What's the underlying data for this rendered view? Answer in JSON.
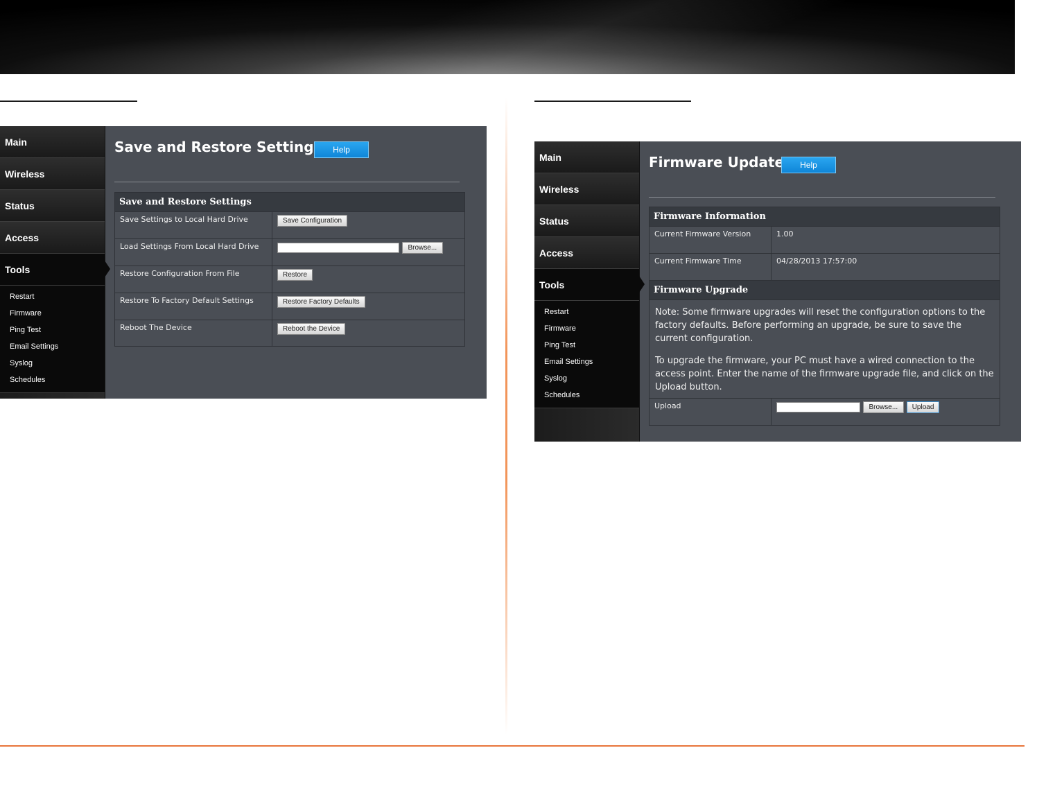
{
  "left_panel": {
    "nav": [
      "Main",
      "Wireless",
      "Status",
      "Access",
      "Tools"
    ],
    "sub_nav": [
      "Restart",
      "Firmware",
      "Ping Test",
      "Email Settings",
      "Syslog",
      "Schedules"
    ],
    "page_title": "Save and Restore Settings",
    "help_label": "Help",
    "section_title": "Save and Restore Settings",
    "rows": [
      {
        "label": "Save Settings to Local Hard Drive",
        "button": "Save Configuration"
      },
      {
        "label": "Load Settings From Local Hard Drive",
        "button": "Browse..."
      },
      {
        "label": "Restore Configuration From File",
        "button": "Restore"
      },
      {
        "label": "Restore To Factory Default Settings",
        "button": "Restore Factory Defaults"
      },
      {
        "label": "Reboot The Device",
        "button": "Reboot the Device"
      }
    ]
  },
  "right_panel": {
    "nav": [
      "Main",
      "Wireless",
      "Status",
      "Access",
      "Tools"
    ],
    "sub_nav": [
      "Restart",
      "Firmware",
      "Ping Test",
      "Email Settings",
      "Syslog",
      "Schedules"
    ],
    "page_title": "Firmware Update",
    "help_label": "Help",
    "info_section": "Firmware Information",
    "info_rows": [
      {
        "label": "Current Firmware Version",
        "value": "1.00"
      },
      {
        "label": "Current Firmware Time",
        "value": "04/28/2013 17:57:00"
      }
    ],
    "upgrade_section": "Firmware Upgrade",
    "note1": "Note: Some firmware upgrades will reset the configuration options to the factory defaults. Before performing an upgrade, be sure to save the current configuration.",
    "note2": "To upgrade the firmware, your PC must have a wired connection to the access point. Enter the name of the firmware upgrade file, and click on the Upload button.",
    "upload_label": "Upload",
    "browse_label": "Browse...",
    "upload_button": "Upload"
  },
  "colors": {
    "accent_line": "#e8743a",
    "help_button": "#1a96e4",
    "panel_bg": "#4a4e55"
  }
}
